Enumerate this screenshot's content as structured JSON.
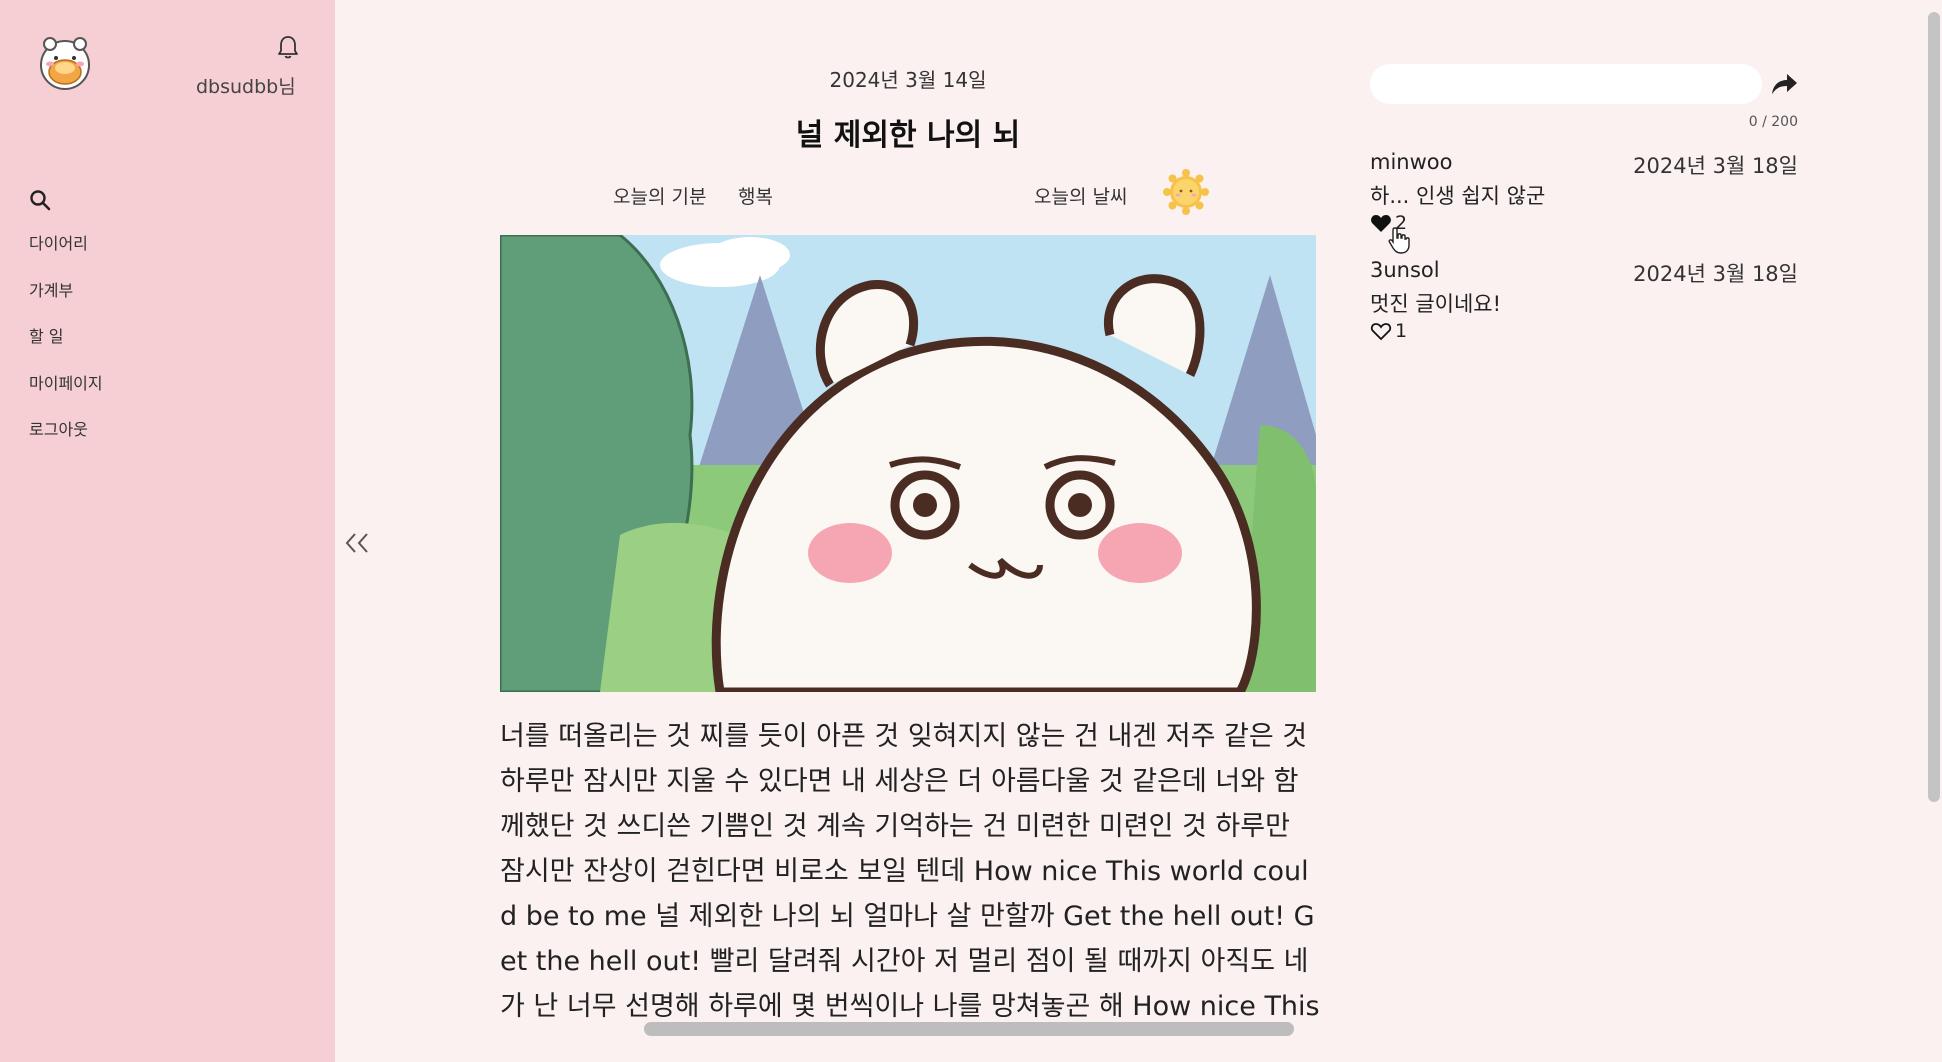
{
  "user": {
    "name": "dbsudbb님",
    "avatar_icon": "chiikawa-avatar-icon"
  },
  "sidebar": {
    "items": [
      {
        "label": "다이어리"
      },
      {
        "label": "가계부"
      },
      {
        "label": "할 일"
      },
      {
        "label": "마이페이지"
      },
      {
        "label": "로그아웃"
      }
    ]
  },
  "post": {
    "date": "2024년 3월 14일",
    "title": "널 제외한 나의 뇌",
    "mood_label": "오늘의 기분",
    "mood_value": "행복",
    "weather_label": "오늘의 날씨",
    "weather_icon": "sun-icon",
    "image": "chiikawa-crying-illustration",
    "body": "너를 떠올리는 것 찌를 듯이 아픈 것 잊혀지지 않는 건 내겐 저주 같은 것 하루만 잠시만 지울 수 있다면 내 세상은 더 아름다울 것 같은데 너와 함께했단 것 쓰디쓴 기쁨인 것 계속 기억하는 건 미련한 미련인 것 하루만 잠시만 잔상이 걷힌다면 비로소 보일 텐데 How nice This world could be to me 널 제외한 나의 뇌 얼마나 살 만할까 Get the hell out! Get the hell out! 빨리 달려줘 시간아 저 멀리 점이 될 때까지 아직도 네가 난 너무 선명해 하루에 몇 번씩이나 나를 망쳐놓곤 해 How nice This"
  },
  "comment_form": {
    "value": "",
    "placeholder": "",
    "count": "0 / 200"
  },
  "comments": [
    {
      "author": "minwoo",
      "date": "2024년 3월 18일",
      "text": "하... 인생 쉽지 않군",
      "likes": "2",
      "liked": true
    },
    {
      "author": "3unsol",
      "date": "2024년 3월 18일",
      "text": "멋진 글이네요!",
      "likes": "1",
      "liked": false
    }
  ],
  "colors": {
    "sidebar_bg": "#f5cfd3",
    "page_bg": "#fbf1f1",
    "cheek": "#f6a6b3"
  }
}
